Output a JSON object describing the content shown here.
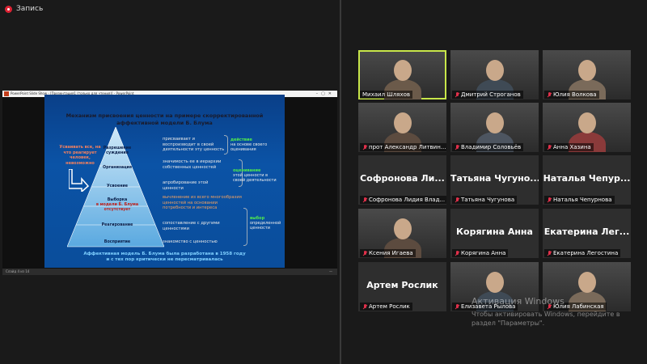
{
  "recording": {
    "label": "Запись"
  },
  "ppt": {
    "window_title": "PowerPoint Slide Show - [Презентация1 (только для чтения)] - PowerPoint",
    "status_left": "Слайд 4 из 14",
    "zoom": "—"
  },
  "slide": {
    "title_line1": "Механизм присвоения ценности на примере скорректированной",
    "title_line2": "аффективной модели Б. Блума",
    "levels": [
      "Разрешение суждения",
      "Организация",
      "Усвоение",
      "Выборка",
      "Реагирование",
      "Восприятие"
    ],
    "level4_note": "в модели Б. Блума отсутствует",
    "descriptions": [
      "присваивает и воспроизводит в своей деятельности эту ценность",
      "значимость ее в иерархии собственных ценностей",
      "апробирование этой ценности",
      "вычленение из всего многообразия ценностей на основании потребности и интереса",
      "сопоставление с другими ценностями",
      "знакомство с ценностью"
    ],
    "groups": [
      {
        "head": "действие",
        "text": "на основе своего оценивания"
      },
      {
        "head": "оценивание",
        "text": "этой ценности в своей деятельности"
      },
      {
        "head": "выбор",
        "text": "определенной ценности"
      }
    ],
    "left_note": "Усваивать все, на что реагирует человек, невозможно",
    "footer_line1": "Аффективная модель Б. Блума была разработана в 1958 году",
    "footer_line2": "и с тех пор критически не пересматривалась"
  },
  "participants": [
    {
      "name": "Михаил Шляхов",
      "kind": "video",
      "muted": false,
      "active": true
    },
    {
      "name": "Дмитрий Строганов",
      "kind": "video",
      "muted": true
    },
    {
      "name": "Юлия Волкова",
      "kind": "video",
      "muted": true
    },
    {
      "name": "прот Александр Литвин...",
      "kind": "video",
      "muted": true
    },
    {
      "name": "Владимир Соловьёв",
      "kind": "video",
      "muted": true
    },
    {
      "name": "Анна Хазина",
      "kind": "photo",
      "muted": true
    },
    {
      "name": "Софронова Лидия Влад...",
      "kind": "name",
      "big": "Софронова Ли...",
      "muted": true
    },
    {
      "name": "Татьяна Чугунова",
      "kind": "name",
      "big": "Татьяна Чугуно...",
      "muted": true
    },
    {
      "name": "Наталья Чепурнова",
      "kind": "name",
      "big": "Наталья Чепур...",
      "muted": true
    },
    {
      "name": "Ксения Игаева",
      "kind": "photo",
      "muted": true
    },
    {
      "name": "Корягина Анна",
      "kind": "name",
      "big": "Корягина Анна",
      "muted": true
    },
    {
      "name": "Екатерина Легостина",
      "kind": "name",
      "big": "Екатерина Лег...",
      "muted": true
    },
    {
      "name": "Артем Рослик",
      "kind": "name",
      "big": "Артем Рослик",
      "muted": true
    },
    {
      "name": "Елизавета Рылова",
      "kind": "photo",
      "muted": true
    },
    {
      "name": "Юлия Лабинская",
      "kind": "photo",
      "muted": true
    }
  ],
  "watermark": {
    "line1": "Активация Windows",
    "line2": "Чтобы активировать Windows, перейдите в раздел \"Параметры\"."
  },
  "colors": {
    "active_speaker": "#c8e64a",
    "muted_icon": "#e0304a",
    "slide_bg": "#0b53a6"
  }
}
